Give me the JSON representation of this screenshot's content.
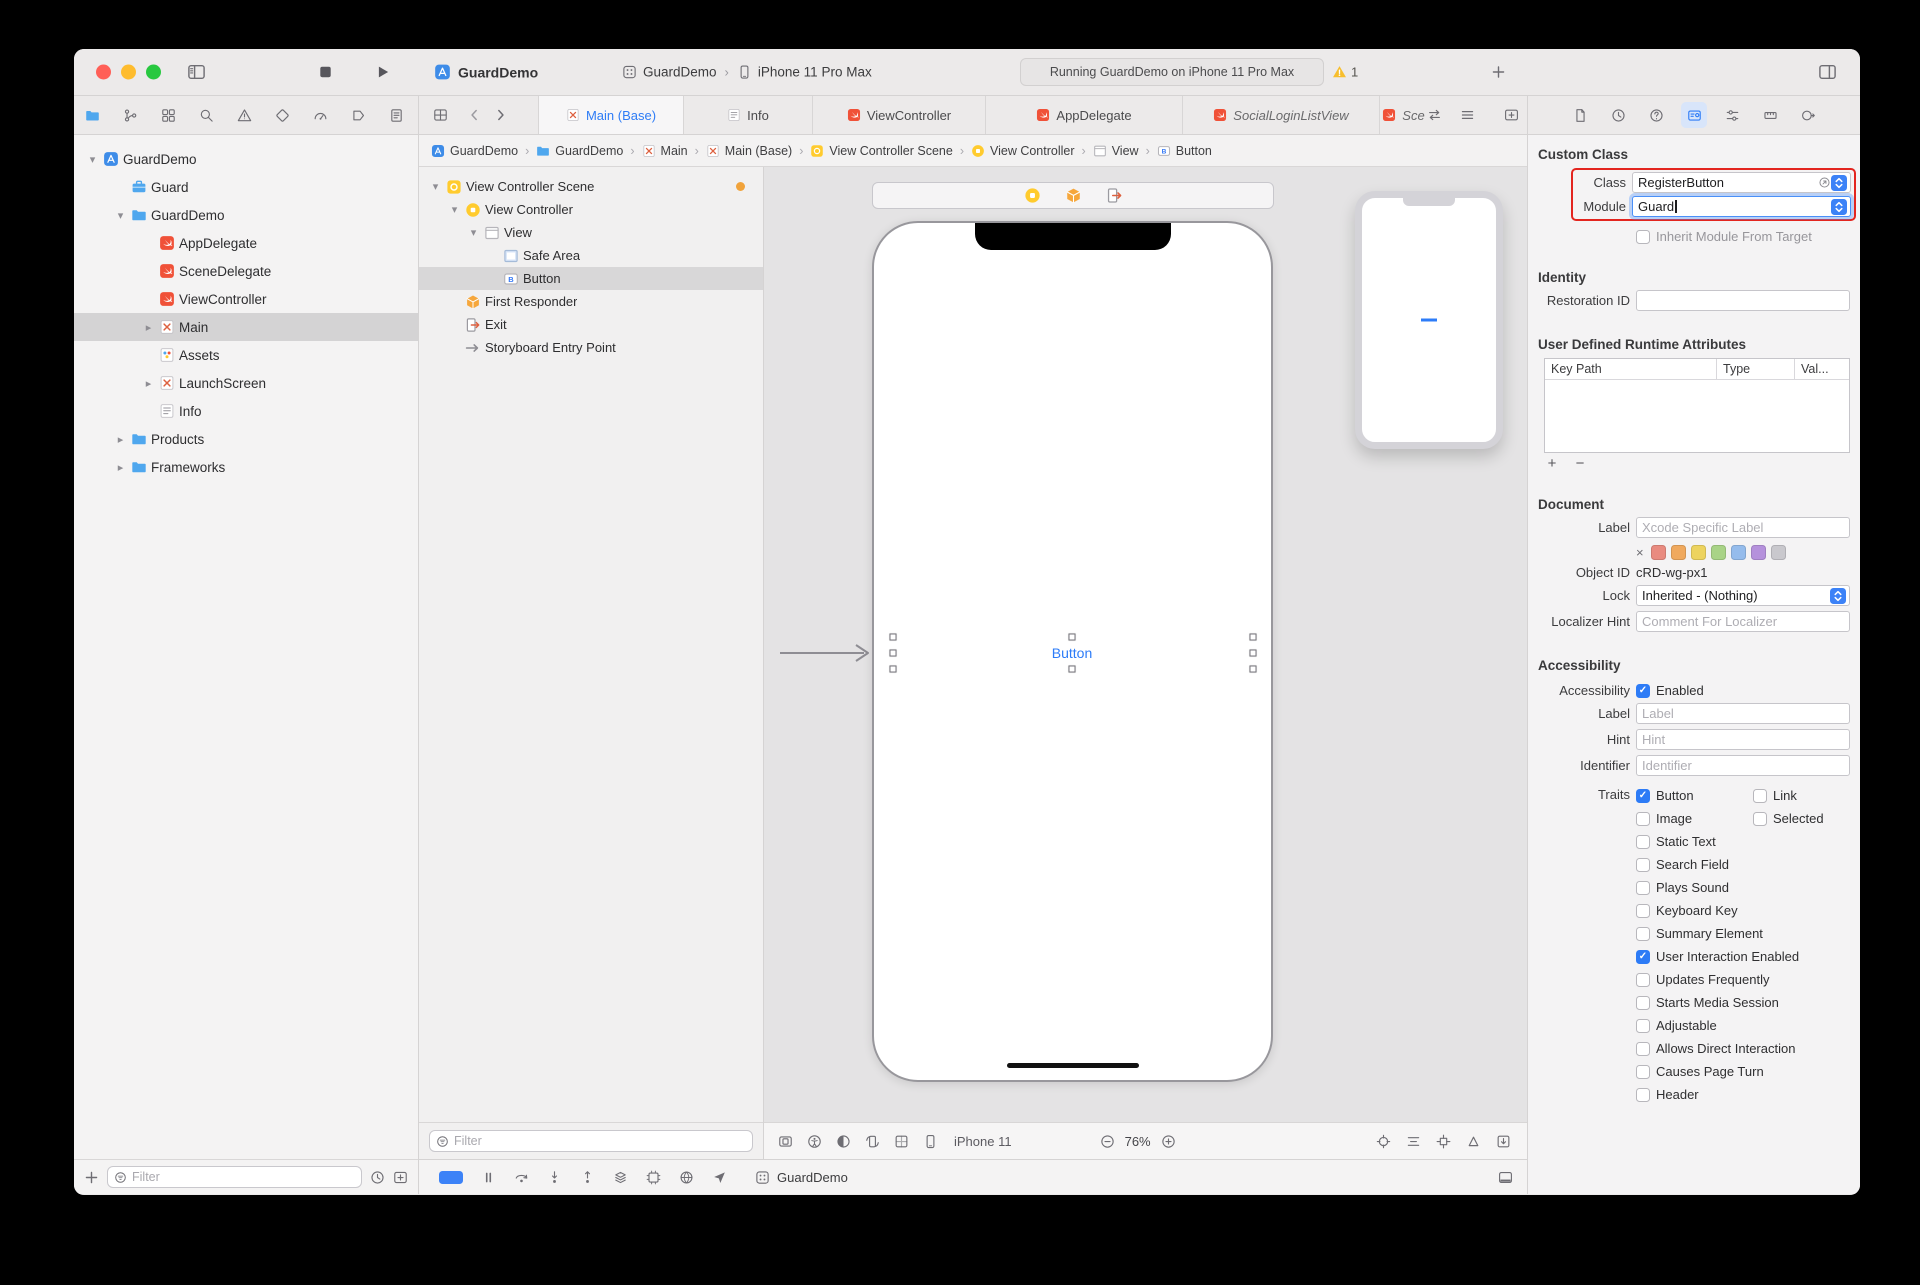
{
  "colors": {
    "accent_blue": "#2E7CF6",
    "annotation_red": "#E3251F",
    "traffic_close": "#FF5F57",
    "traffic_minimize": "#FEBC2E",
    "traffic_zoom": "#28C840",
    "swift_orange": "#F05138",
    "storyboard_yellow": "#FFCB2E"
  },
  "titlebar": {
    "project_title": "GuardDemo",
    "scheme_name": "GuardDemo",
    "run_destination": "iPhone 11 Pro Max",
    "status_text": "Running GuardDemo on iPhone 11 Pro Max",
    "warning_count": "1"
  },
  "navigator_tab_icons": [
    "folder",
    "source-control",
    "symbols",
    "find",
    "issues",
    "tests",
    "debug-gauge",
    "breakpoints",
    "reports"
  ],
  "inspector_tab_icons": [
    "file-insp",
    "history-insp",
    "help-insp",
    "identity-insp",
    "attributes-insp",
    "size-insp",
    "connections-insp"
  ],
  "editor_tabs": [
    {
      "label": "Main (Base)",
      "icon": "storyboard",
      "active": true,
      "italic": false
    },
    {
      "label": "Info",
      "icon": "plist",
      "active": false,
      "italic": false
    },
    {
      "label": "ViewController",
      "icon": "swift",
      "active": false,
      "italic": false
    },
    {
      "label": "AppDelegate",
      "icon": "swift",
      "active": false,
      "italic": false
    },
    {
      "label": "SocialLoginListView",
      "icon": "swift",
      "active": false,
      "italic": true
    },
    {
      "label": "Sce",
      "icon": "swift",
      "active": false,
      "italic": true
    }
  ],
  "jump_bar": [
    {
      "label": "GuardDemo",
      "icon": "project"
    },
    {
      "label": "GuardDemo",
      "icon": "folder"
    },
    {
      "label": "Main",
      "icon": "storyboard"
    },
    {
      "label": "Main (Base)",
      "icon": "storyboard"
    },
    {
      "label": "View Controller Scene",
      "icon": "scene"
    },
    {
      "label": "View Controller",
      "icon": "vc"
    },
    {
      "label": "View",
      "icon": "view"
    },
    {
      "label": "Button",
      "icon": "button-ic"
    }
  ],
  "navigator": {
    "items": [
      {
        "label": "GuardDemo",
        "icon": "project",
        "level": 0,
        "chevron": "open",
        "selected": false
      },
      {
        "label": "Guard",
        "icon": "framework",
        "level": 1,
        "chevron": "",
        "selected": false
      },
      {
        "label": "GuardDemo",
        "icon": "folder",
        "level": 1,
        "chevron": "open",
        "selected": false
      },
      {
        "label": "AppDelegate",
        "icon": "swift",
        "level": 2,
        "chevron": "",
        "selected": false
      },
      {
        "label": "SceneDelegate",
        "icon": "swift",
        "level": 2,
        "chevron": "",
        "selected": false
      },
      {
        "label": "ViewController",
        "icon": "swift",
        "level": 2,
        "chevron": "",
        "selected": false
      },
      {
        "label": "Main",
        "icon": "storyboard",
        "level": 2,
        "chevron": "closed",
        "selected": true
      },
      {
        "label": "Assets",
        "icon": "assets",
        "level": 2,
        "chevron": "",
        "selected": false
      },
      {
        "label": "LaunchScreen",
        "icon": "storyboard",
        "level": 2,
        "chevron": "closed",
        "selected": false
      },
      {
        "label": "Info",
        "icon": "plist",
        "level": 2,
        "chevron": "",
        "selected": false
      },
      {
        "label": "Products",
        "icon": "folder",
        "level": 1,
        "chevron": "closed",
        "selected": false
      },
      {
        "label": "Frameworks",
        "icon": "folder",
        "level": 1,
        "chevron": "closed",
        "selected": false
      }
    ],
    "filter_placeholder": "Filter"
  },
  "outline": {
    "items": [
      {
        "label": "View Controller Scene",
        "icon": "scene",
        "level": 0,
        "chevron": "open",
        "selected": false,
        "badge": true
      },
      {
        "label": "View Controller",
        "icon": "vc",
        "level": 1,
        "chevron": "open",
        "selected": false,
        "badge": false
      },
      {
        "label": "View",
        "icon": "view",
        "level": 2,
        "chevron": "open",
        "selected": false,
        "badge": false
      },
      {
        "label": "Safe Area",
        "icon": "safearea",
        "level": 3,
        "chevron": "",
        "selected": false,
        "badge": false
      },
      {
        "label": "Button",
        "icon": "button-ic",
        "level": 3,
        "chevron": "",
        "selected": true,
        "badge": false
      },
      {
        "label": "First Responder",
        "icon": "responder",
        "level": 1,
        "chevron": "",
        "selected": false,
        "badge": false
      },
      {
        "label": "Exit",
        "icon": "exit",
        "level": 1,
        "chevron": "",
        "selected": false,
        "badge": false
      },
      {
        "label": "Storyboard Entry Point",
        "icon": "entry",
        "level": 1,
        "chevron": "",
        "selected": false,
        "badge": false
      }
    ],
    "filter_placeholder": "Filter"
  },
  "canvas": {
    "button_label": "Button",
    "device_name": "iPhone 11",
    "zoom_level": "76%",
    "left_icons": [
      "bezel",
      "accessibility",
      "appearance",
      "rotate",
      "adjust",
      "phone-ic"
    ],
    "right_icons": [
      "scope",
      "align",
      "pin",
      "resolve",
      "embed"
    ]
  },
  "debug_bar": {
    "app_name": "GuardDemo",
    "step_icons": [
      "pause",
      "step-over",
      "step-in",
      "step-out"
    ],
    "tool_icons": [
      "hierarchy",
      "memory",
      "environment",
      "location"
    ]
  },
  "inspector": {
    "custom_class": {
      "title": "Custom Class",
      "class_label": "Class",
      "class_value": "RegisterButton",
      "module_label": "Module",
      "module_value": "Guard",
      "inherit_checkbox_label": "Inherit Module From Target"
    },
    "identity": {
      "title": "Identity",
      "restoration_id_label": "Restoration ID"
    },
    "runtime_attributes": {
      "title": "User Defined Runtime Attributes",
      "columns": [
        "Key Path",
        "Type",
        "Val..."
      ]
    },
    "document": {
      "title": "Document",
      "label_label": "Label",
      "label_placeholder": "Xcode Specific Label",
      "swatches": [
        "#E98B80",
        "#F0A95E",
        "#EDD35F",
        "#A9D387",
        "#95BCEC",
        "#B591DC",
        "#C9C8CD"
      ],
      "object_id_label": "Object ID",
      "object_id_value": "cRD-wg-px1",
      "lock_label": "Lock",
      "lock_value": "Inherited - (Nothing)",
      "localizer_hint_label": "Localizer Hint",
      "localizer_hint_placeholder": "Comment For Localizer"
    },
    "accessibility": {
      "title": "Accessibility",
      "accessibility_label": "Accessibility",
      "enabled_label": "Enabled",
      "label_label": "Label",
      "label_placeholder": "Label",
      "hint_label": "Hint",
      "hint_placeholder": "Hint",
      "identifier_label": "Identifier",
      "identifier_placeholder": "Identifier",
      "traits_label": "Traits",
      "trait_rows": [
        [
          {
            "label": "Button",
            "checked": true
          },
          {
            "label": "Link",
            "checked": false
          }
        ],
        [
          {
            "label": "Image",
            "checked": false
          },
          {
            "label": "Selected",
            "checked": false
          }
        ],
        [
          {
            "label": "Static Text",
            "checked": false
          }
        ],
        [
          {
            "label": "Search Field",
            "checked": false
          }
        ],
        [
          {
            "label": "Plays Sound",
            "checked": false
          }
        ],
        [
          {
            "label": "Keyboard Key",
            "checked": false
          }
        ],
        [
          {
            "label": "Summary Element",
            "checked": false
          }
        ],
        [
          {
            "label": "User Interaction Enabled",
            "checked": true
          }
        ],
        [
          {
            "label": "Updates Frequently",
            "checked": false
          }
        ],
        [
          {
            "label": "Starts Media Session",
            "checked": false
          }
        ],
        [
          {
            "label": "Adjustable",
            "checked": false
          }
        ],
        [
          {
            "label": "Allows Direct Interaction",
            "checked": false
          }
        ],
        [
          {
            "label": "Causes Page Turn",
            "checked": false
          }
        ],
        [
          {
            "label": "Header",
            "checked": false
          }
        ]
      ]
    }
  }
}
